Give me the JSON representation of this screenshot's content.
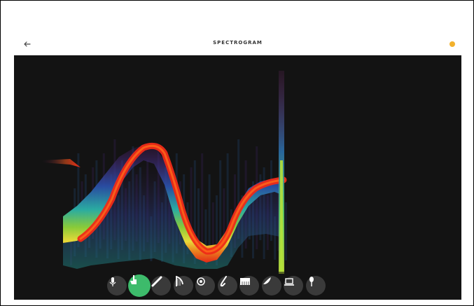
{
  "header": {
    "title": "SPECTROGRAM",
    "back_icon": "arrow-left-icon",
    "status_color": "#f2b12c"
  },
  "colors": {
    "canvas_bg": "#131313",
    "active_tool": "#3dbb6b",
    "tool_bg": "#3a3a3a"
  },
  "toolbar": {
    "active_index": 1,
    "tools": [
      {
        "name": "microphone-icon"
      },
      {
        "name": "hand-pointer-icon"
      },
      {
        "name": "flute-icon"
      },
      {
        "name": "harp-icon"
      },
      {
        "name": "drum-icon"
      },
      {
        "name": "saxophone-icon"
      },
      {
        "name": "keyboard-icon"
      },
      {
        "name": "bird-icon"
      },
      {
        "name": "laptop-icon"
      },
      {
        "name": "voice-mic-icon"
      }
    ]
  }
}
